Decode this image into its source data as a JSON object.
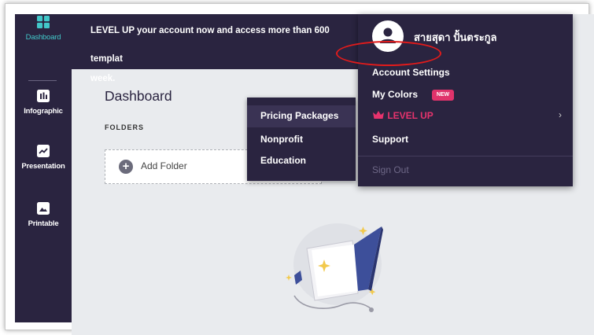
{
  "sidebar": {
    "items": [
      {
        "label": "Dashboard",
        "icon": "dashboard-grid-icon",
        "active": true
      },
      {
        "label": "Infographic",
        "icon": "bar-chart-icon",
        "active": false
      },
      {
        "label": "Presentation",
        "icon": "trend-chart-icon",
        "active": false
      },
      {
        "label": "Printable",
        "icon": "image-icon",
        "active": false
      }
    ]
  },
  "banner": {
    "line1": "LEVEL UP your account now and access more than 600 templat",
    "line2": "week."
  },
  "main": {
    "title": "Dashboard",
    "folders_label": "FOLDERS",
    "add_folder_label": "Add Folder"
  },
  "pricing_menu": {
    "items": [
      "Pricing Packages",
      "Nonprofit",
      "Education"
    ]
  },
  "account_menu": {
    "user_name": "สายสุดา ปั้นตระกูล",
    "account_settings": "Account Settings",
    "my_colors": "My Colors",
    "new_badge": "NEW",
    "level_up": "LEVEL UP",
    "support": "Support",
    "sign_out": "Sign Out"
  },
  "colors": {
    "sidebar_bg": "#2a2440",
    "accent_teal": "#42c7c9",
    "accent_pink": "#e0336b",
    "annotation_red": "#e11b1b"
  }
}
